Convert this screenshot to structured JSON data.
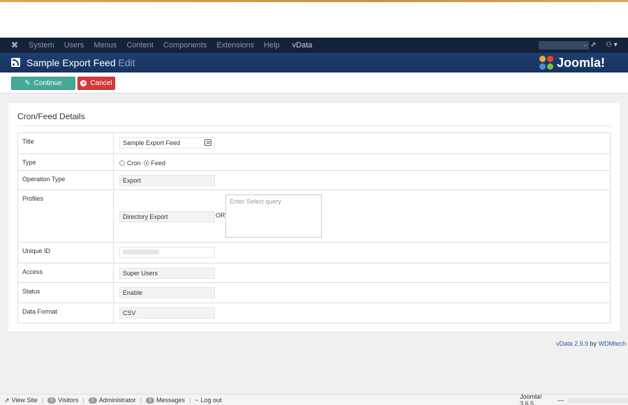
{
  "navbar": {
    "menu": [
      "System",
      "Users",
      "Menus",
      "Content",
      "Components",
      "Extensions",
      "Help",
      "vData"
    ],
    "site_dots": "..",
    "ext_icon": "external-link-icon",
    "user_icon": "user-icon"
  },
  "titlebar": {
    "title": "Sample Export Feed",
    "edit": "Edit",
    "brand": "Joomla!",
    "color": "#1a3867"
  },
  "toolbar": {
    "continue_label": "Continue",
    "cancel_label": "Cancel",
    "continue_color": "#46a897",
    "cancel_color": "#d33a3a"
  },
  "card": {
    "title": "Cron/Feed Details"
  },
  "form": {
    "title_label": "Title",
    "title_value": "Sample Export Feed",
    "type_label": "Type",
    "type_options": [
      "Cron",
      "Feed"
    ],
    "type_selected": "Feed",
    "operation_label": "Operation Type",
    "operation_value": "Export",
    "profiles_label": "Profiles",
    "profiles_value": "Directory Export",
    "or_text": "OR",
    "query_placeholder": "Enter Select query",
    "uid_label": "Unique ID",
    "access_label": "Access",
    "access_value": "Super Users",
    "status_label": "Status",
    "status_value": "Enable",
    "format_label": "Data Format",
    "format_value": "CSV"
  },
  "credit": {
    "version": "vData 2.9.9",
    "by": "by",
    "author": "WDMtech"
  },
  "footer": {
    "view_site": "View Site",
    "visitors_count": "0",
    "visitors": "Visitors",
    "admin_count": "1",
    "admin": "Administrator",
    "messages_count": "0",
    "messages": "Messages",
    "logout": "Log out",
    "version": "Joomla! 3.6.5",
    "dash": "—"
  }
}
